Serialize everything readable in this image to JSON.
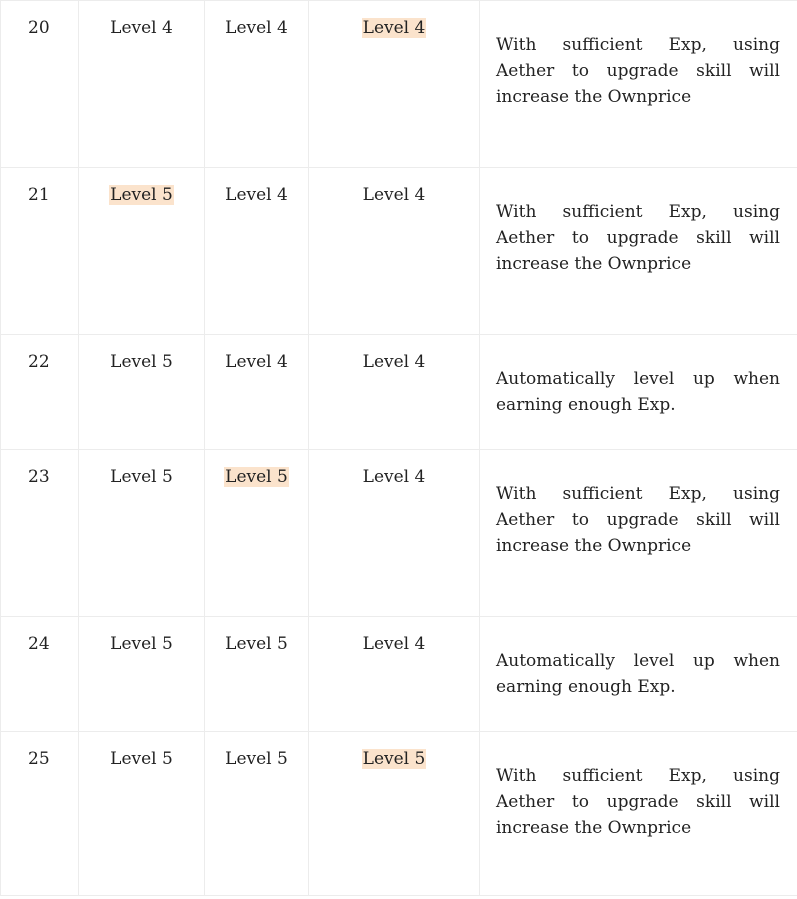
{
  "rows": [
    {
      "no": "20",
      "a": "Level 4",
      "b": "Level 4",
      "c": "Level 4",
      "desc": "With sufficient Exp, using Aether to upgrade skill will increase the Ownprice",
      "highlight": "c"
    },
    {
      "no": "21",
      "a": "Level 5",
      "b": "Level 4",
      "c": "Level 4",
      "desc": "With sufficient Exp, using Aether to upgrade skill will increase the Ownprice",
      "highlight": "a"
    },
    {
      "no": "22",
      "a": "Level 5",
      "b": "Level 4",
      "c": "Level 4",
      "desc": "Automatically level up when earning enough Exp.",
      "highlight": ""
    },
    {
      "no": "23",
      "a": "Level 5",
      "b": "Level 5",
      "c": "Level 4",
      "desc": "With sufficient Exp, using Aether to upgrade skill will increase the Ownprice",
      "highlight": "b"
    },
    {
      "no": "24",
      "a": "Level 5",
      "b": "Level 5",
      "c": "Level 4",
      "desc": "Automatically level up when earning enough Exp.",
      "highlight": ""
    },
    {
      "no": "25",
      "a": "Level 5",
      "b": "Level 5",
      "c": "Level 5",
      "desc": "With sufficient Exp, using Aether to upgrade skill will increase the Ownprice",
      "highlight": "c"
    }
  ],
  "colors": {
    "highlight": "#fbe3cc",
    "border": "#ececec",
    "text": "#222222"
  }
}
